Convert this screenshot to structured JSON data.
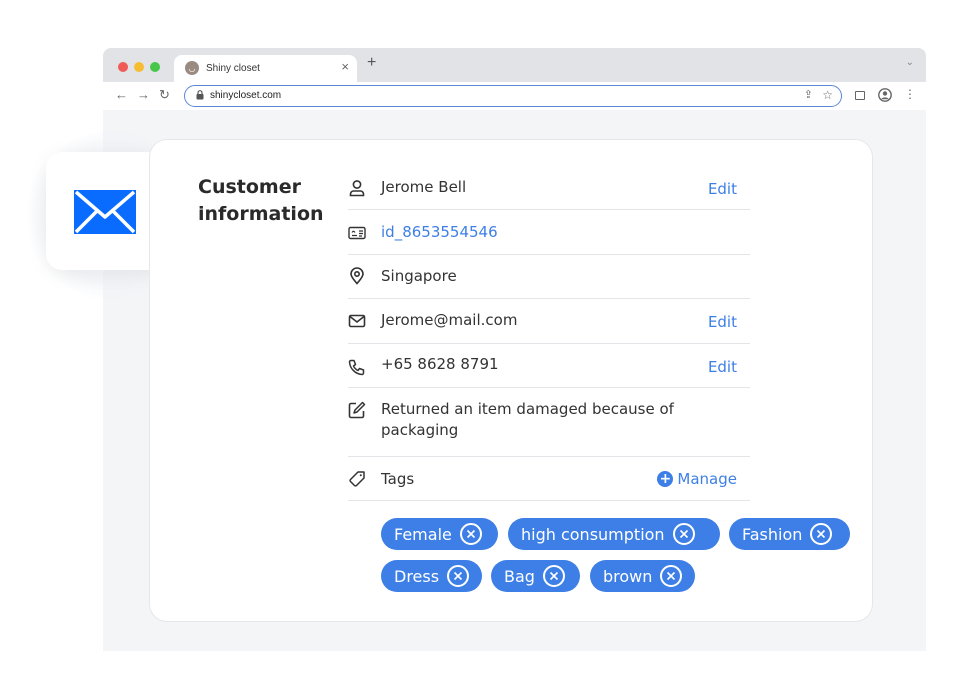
{
  "browser": {
    "tab_title": "Shiny closet",
    "tab_close": "×",
    "new_tab": "+",
    "tab_menu": "⌄",
    "url": "shinycloset.com",
    "nav": {
      "back": "←",
      "forward": "→",
      "reload": "↻"
    },
    "icons": {
      "share": "⇪",
      "star": "☆",
      "kebab": "⋮"
    }
  },
  "customer": {
    "title": "Customer information",
    "name": "Jerome Bell",
    "id": "id_8653554546",
    "location": "Singapore",
    "email": "Jerome@mail.com",
    "phone": "+65 8628 8791",
    "note": "Returned an item damaged because of packaging",
    "tags_label": "Tags",
    "edit_label": "Edit",
    "manage_label": "Manage",
    "tags": [
      "Female",
      "high consumption",
      "Fashion",
      "Dress",
      "Bag",
      "brown"
    ]
  },
  "colors": {
    "accent": "#3d7fe6",
    "mail_icon": "#0a6cff",
    "traffic_red": "#f05a57",
    "traffic_yellow": "#f6bd33",
    "traffic_green": "#46c74a"
  },
  "icons": {
    "mail": "mail-icon",
    "person": "person-icon",
    "id_card": "id-card-icon",
    "location": "location-pin-icon",
    "envelope": "envelope-icon",
    "phone": "phone-icon",
    "note": "edit-note-icon",
    "tag": "tag-icon",
    "plus": "plus-circle-icon",
    "remove": "close-circle-icon"
  }
}
